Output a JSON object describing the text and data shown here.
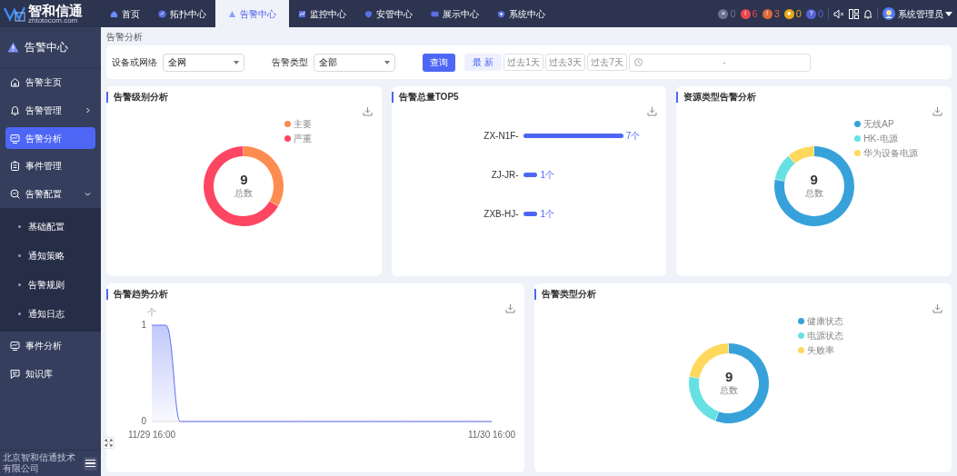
{
  "logo": {
    "name": "智和信通",
    "subtitle": "zhtotocom.com"
  },
  "nav_tabs": [
    {
      "label": "首页",
      "selected": false
    },
    {
      "label": "拓扑中心",
      "selected": false
    },
    {
      "label": "告警中心",
      "selected": true
    },
    {
      "label": "监控中心",
      "selected": false
    },
    {
      "label": "安管中心",
      "selected": false
    },
    {
      "label": "展示中心",
      "selected": false
    },
    {
      "label": "系统中心",
      "selected": false
    }
  ],
  "alarm_counts": [
    {
      "symbol": "×",
      "count": "0",
      "color": "#6b7391"
    },
    {
      "symbol": "!",
      "count": "6",
      "color": "#e8454f"
    },
    {
      "symbol": "!",
      "count": "3",
      "color": "#d9693c"
    },
    {
      "symbol": "●",
      "count": "0",
      "color": "#e6a817"
    },
    {
      "symbol": "?",
      "count": "0",
      "color": "#5661d6"
    }
  ],
  "user": {
    "name": "系统管理员"
  },
  "sidebar": {
    "title": "告警中心",
    "items": [
      {
        "label": "告警主页",
        "selected": false
      },
      {
        "label": "告警管理",
        "selected": false,
        "expanded": false
      },
      {
        "label": "告警分析",
        "selected": true
      },
      {
        "label": "事件管理",
        "selected": false
      },
      {
        "label": "告警配置",
        "selected": false,
        "expanded": true,
        "children": [
          {
            "label": "基础配置",
            "selected": false
          },
          {
            "label": "通知策略",
            "selected": false
          },
          {
            "label": "告警规则",
            "selected": false
          },
          {
            "label": "通知日志",
            "selected": false
          }
        ]
      },
      {
        "label": "事件分析",
        "selected": false
      },
      {
        "label": "知识库",
        "selected": false
      }
    ],
    "footer": "北京智和信通技术有限公司"
  },
  "breadcrumb": "告警分析",
  "filters": {
    "device_label": "设备或网络",
    "device_value": "全网",
    "type_label": "告警类型",
    "type_value": "全部",
    "query_button": "查询",
    "ranges": [
      {
        "label": "最 新",
        "selected": true
      },
      {
        "label": "过去1天",
        "selected": false
      },
      {
        "label": "过去3天",
        "selected": false
      },
      {
        "label": "过去7天",
        "selected": false
      }
    ],
    "date_separator": "-"
  },
  "level_panel": {
    "title": "告警级别分析",
    "center_value": "9",
    "center_label": "总数",
    "legend": [
      {
        "color": "#fe8c50"
      },
      {
        "color": "#fd4662"
      }
    ],
    "chart_data": {
      "type": "donut",
      "categories": [
        "主要",
        "严重"
      ],
      "values": [
        33.33,
        66.67
      ]
    }
  },
  "top5_panel": {
    "title": "告警总量TOP5",
    "chart_data": {
      "type": "bar",
      "orientation": "horizontal",
      "categories": [
        "ZX-N1F-",
        "ZJ-JR-",
        "ZXB-HJ-"
      ],
      "values": [
        7,
        1,
        1
      ],
      "value_labels": [
        "7个",
        "1个",
        "1个"
      ]
    }
  },
  "resource_panel": {
    "title": "资源类型告警分析",
    "center_value": "9",
    "center_label": "总数",
    "legend": [
      {
        "color": "#37a2da"
      },
      {
        "color": "#67e0e3"
      },
      {
        "color": "#ffd85c"
      }
    ],
    "chart_data": {
      "type": "donut",
      "categories": [
        "无线AP",
        "HK-电源",
        "华为设备电源"
      ],
      "values": [
        77.78,
        11.11,
        11.11
      ]
    }
  },
  "trend_panel": {
    "title": "告警趋势分析",
    "chart_data": {
      "type": "area",
      "ylabel": "个",
      "categories": [
        "11/29 16:00",
        null,
        null,
        null,
        null,
        null,
        null,
        null,
        null,
        null,
        null,
        null,
        null,
        null,
        null,
        null,
        null,
        null,
        null,
        null,
        null,
        null,
        null,
        null,
        "11/30 16:00"
      ],
      "series": [
        {
          "color": "#5b6ef5",
          "values": [
            1,
            1,
            0,
            0,
            0,
            0,
            0,
            0,
            0,
            0,
            0,
            0,
            0,
            0,
            0,
            0,
            0,
            0,
            0,
            0,
            0,
            0,
            0,
            0,
            0
          ]
        }
      ],
      "ylim": [
        0,
        1
      ],
      "yticks": [
        0,
        1
      ]
    }
  },
  "type_panel": {
    "title": "告警类型分析",
    "center_value": "9",
    "center_label": "总数",
    "legend": [
      {
        "color": "#37a2da"
      },
      {
        "color": "#67e0e3"
      },
      {
        "color": "#ffd85c"
      }
    ],
    "chart_data": {
      "type": "donut",
      "categories": [
        "健康状态",
        "电源状态",
        "失败率"
      ],
      "values": [
        55.56,
        22.22,
        22.22
      ]
    }
  }
}
